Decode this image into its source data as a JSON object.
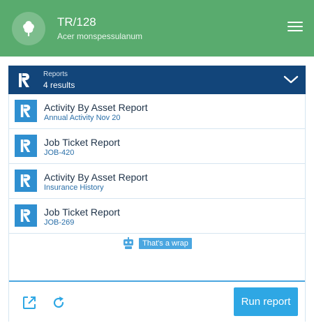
{
  "header": {
    "title": "TR/128",
    "subtitle": "Acer monspessulanum",
    "icon": "tree-icon"
  },
  "panel": {
    "heading": "Reports",
    "count": "4 results",
    "logo": "report-logo-icon"
  },
  "reports": [
    {
      "title": "Activity By Asset Report",
      "subtitle": "Annual Activity Nov 20"
    },
    {
      "title": "Job Ticket Report",
      "subtitle": "JOB-420"
    },
    {
      "title": "Activity By Asset Report",
      "subtitle": "Insurance History"
    },
    {
      "title": "Job Ticket Report",
      "subtitle": "JOB-269"
    }
  ],
  "end_message": "That's a wrap",
  "footer": {
    "run_label": "Run report",
    "icons": [
      "external-link-icon",
      "refresh-icon"
    ]
  },
  "colors": {
    "header_bg": "#59ab6e",
    "panel_header_bg": "#12457a",
    "accent": "#2ea7e4",
    "report_icon_bg": "#2f8fd0"
  }
}
